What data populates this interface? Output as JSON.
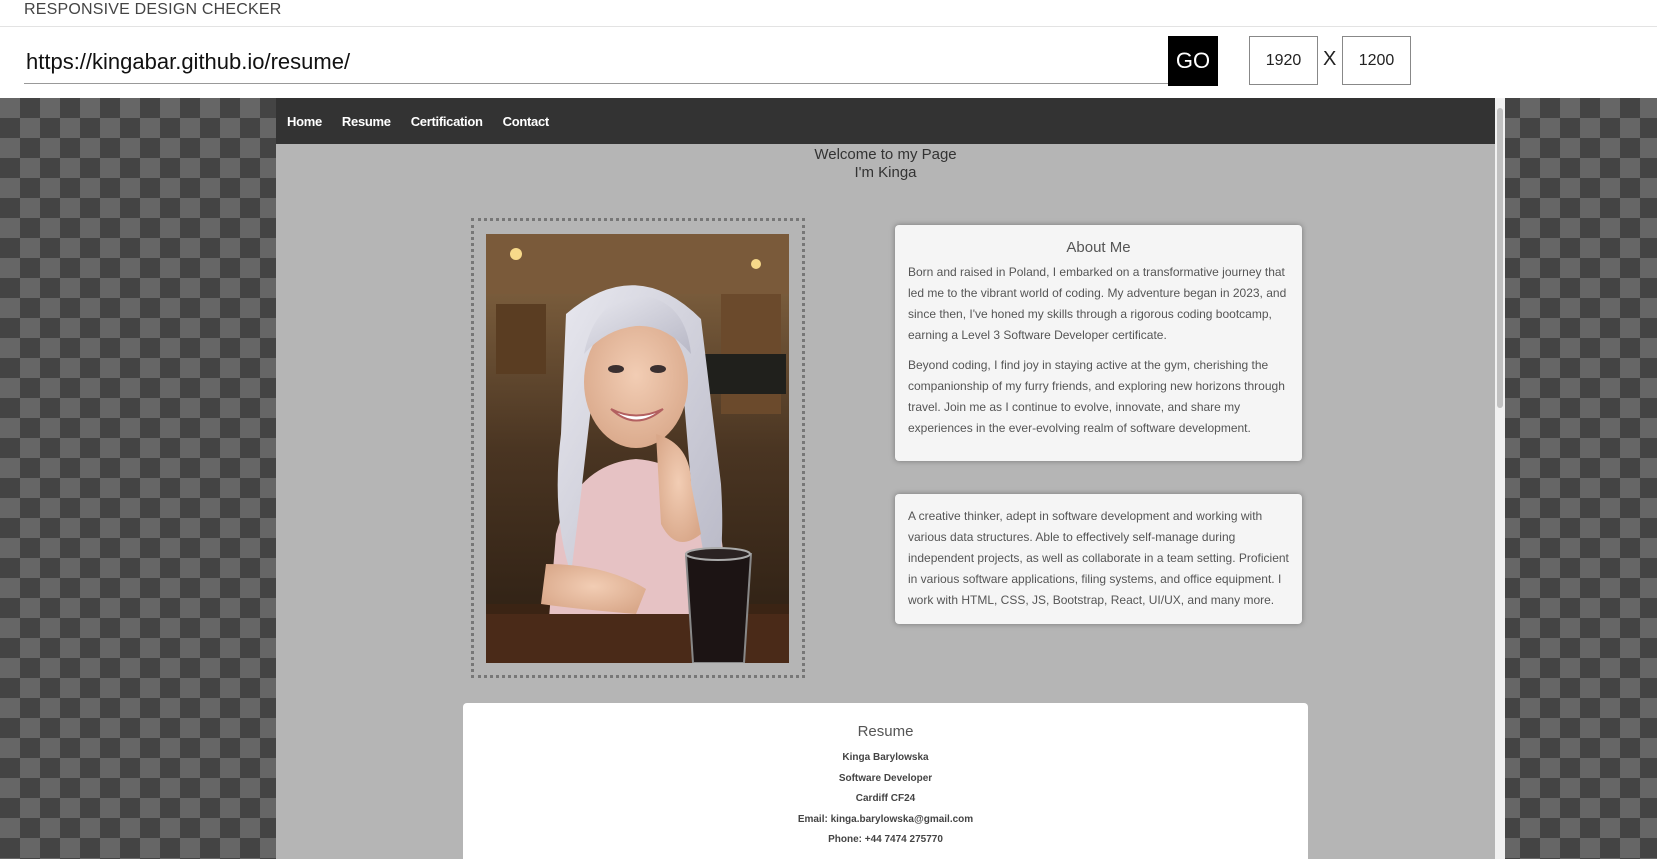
{
  "app": {
    "title": "RESPONSIVE DESIGN CHECKER"
  },
  "toolbar": {
    "url_value": "https://kingabar.github.io/resume/",
    "go_label": "GO",
    "width_value": "1920",
    "x_label": "X",
    "height_value": "1200"
  },
  "site": {
    "nav": [
      {
        "label": "Home"
      },
      {
        "label": "Resume"
      },
      {
        "label": "Certification"
      },
      {
        "label": "Contact"
      }
    ],
    "welcome_line1": "Welcome to my Page",
    "welcome_line2": "I'm Kinga",
    "about": {
      "heading": "About Me",
      "p1": "Born and raised in Poland, I embarked on a transformative journey that led me to the vibrant world of coding. My adventure began in 2023, and since then, I've honed my skills through a rigorous coding bootcamp, earning a Level 3 Software Developer certificate.",
      "p2": "Beyond coding, I find joy in staying active at the gym, cherishing the companionship of my furry friends, and exploring new horizons through travel. Join me as I continue to evolve, innovate, and share my experiences in the ever-evolving realm of software development."
    },
    "summary": "A creative thinker, adept in software development and working with various data structures. Able to effectively self-manage during independent projects, as well as collaborate in a team setting. Proficient in various software applications, filing systems, and office equipment. I work with HTML, CSS, JS, Bootstrap, React, UI/UX, and many more.",
    "resume": {
      "heading": "Resume",
      "name": "Kinga Barylowska",
      "role": "Software Developer",
      "location": "Cardiff CF24",
      "email": "Email: kinga.barylowska@gmail.com",
      "phone": "Phone: +44 7474 275770"
    }
  },
  "colors": {
    "nav_bg": "#333333",
    "site_bg": "#b5b5b5",
    "go_bg": "#000000"
  }
}
